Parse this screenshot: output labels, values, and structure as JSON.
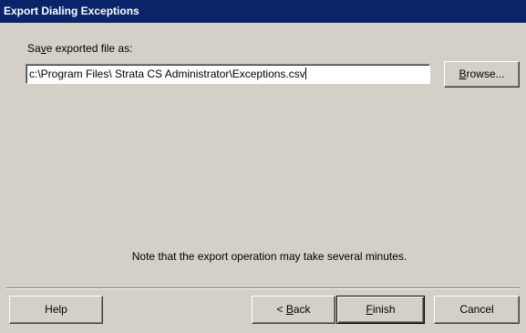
{
  "window": {
    "title": "Export Dialing Exceptions"
  },
  "form": {
    "save_label_pre": "Sa",
    "save_label_mnemonic": "v",
    "save_label_post": "e exported file as:",
    "path_value": "c:\\Program Files\\  Strata CS  Administrator\\Exceptions.csv",
    "browse_mnemonic": "B",
    "browse_rest": "rowse..."
  },
  "note": "Note that the export operation may take several minutes.",
  "buttons": {
    "help": "Help",
    "back_prefix": "< ",
    "back_mnemonic": "B",
    "back_rest": "ack",
    "finish_mnemonic": "F",
    "finish_rest": "inish",
    "cancel": "Cancel"
  },
  "colors": {
    "titlebar": "#0a246a",
    "face": "#d4d0c8",
    "field": "#ffffff"
  }
}
